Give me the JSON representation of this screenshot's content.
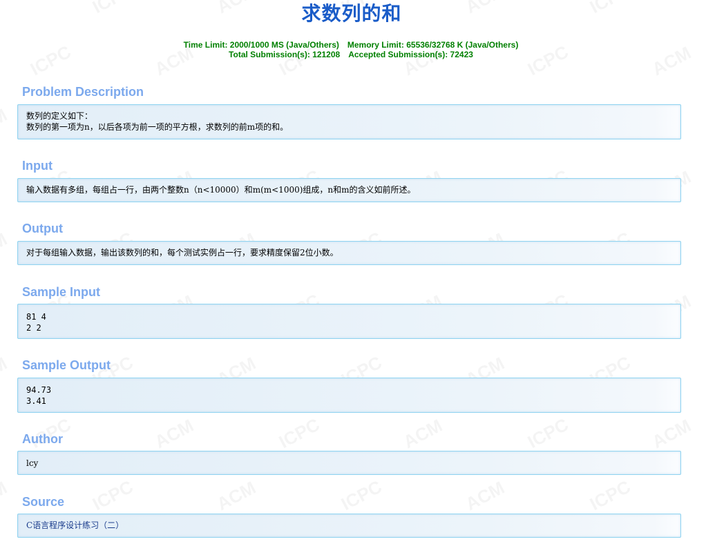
{
  "problem": {
    "title": "求数列的和",
    "meta": {
      "time_limit": "Time Limit: 2000/1000 MS (Java/Others)",
      "memory_limit": "Memory Limit: 65536/32768 K (Java/Others)",
      "total_submissions": "Total Submission(s): 121208",
      "accepted_submissions": "Accepted Submission(s): 72423"
    }
  },
  "sections": {
    "description": {
      "heading": "Problem Description",
      "lines": [
        "数列的定义如下：",
        "数列的第一项为n，以后各项为前一项的平方根，求数列的前m项的和。"
      ]
    },
    "input": {
      "heading": "Input",
      "lines": [
        "输入数据有多组，每组占一行，由两个整数n（n<10000）和m(m<1000)组成，n和m的含义如前所述。"
      ]
    },
    "output": {
      "heading": "Output",
      "lines": [
        "对于每组输入数据，输出该数列的和，每个测试实例占一行，要求精度保留2位小数。"
      ]
    },
    "sample_input": {
      "heading": "Sample Input",
      "lines": [
        "81 4",
        "2 2"
      ]
    },
    "sample_output": {
      "heading": "Sample Output",
      "lines": [
        "94.73",
        "3.41"
      ]
    },
    "author": {
      "heading": "Author",
      "lines": [
        "lcy"
      ]
    },
    "source": {
      "heading": "Source",
      "link": "C语言程序设计练习（二）"
    }
  },
  "watermark": {
    "text_a": "ACM",
    "text_b": "ICPC"
  },
  "colors": {
    "title": "#1a5cc8",
    "meta": "#008000",
    "heading": "#7ca9ed",
    "panel_border": "#8fd3f0",
    "link": "#1a3c8c"
  }
}
